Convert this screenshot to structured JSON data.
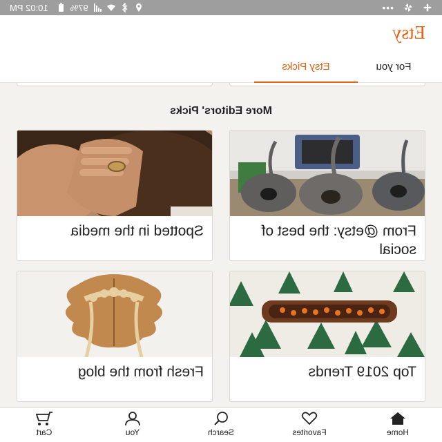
{
  "status_bar": {
    "time": "10:02 PM",
    "battery": "97%",
    "icons": [
      "battery-icon",
      "signal-icon",
      "wifi-icon",
      "bluetooth-icon",
      "location-icon",
      "more-icon",
      "pinwheel-icon",
      "fan-icon"
    ]
  },
  "header": {
    "logo": "Etsy",
    "tabs": [
      {
        "label": "For you",
        "active": false
      },
      {
        "label": "Etsy Picks",
        "active": true
      }
    ],
    "accent_color": "#e8600d"
  },
  "main": {
    "section_title": "More Editors' Picks",
    "cards": [
      {
        "title": "From @etsy: the best of social",
        "image": "felt-cat-pods-photo"
      },
      {
        "title": "Spotted in the media",
        "image": "woman-with-ring-photo"
      },
      {
        "title": "Top 2019 Trends",
        "image": "wooden-tray-pine-trees-photo"
      },
      {
        "title": "Fresh from the blog",
        "image": "leaf-hair-pin-photo"
      }
    ]
  },
  "bottom_nav": {
    "items": [
      {
        "label": "Home",
        "icon": "home-icon",
        "active": true
      },
      {
        "label": "Favorites",
        "icon": "heart-icon",
        "active": false
      },
      {
        "label": "Search",
        "icon": "search-icon",
        "active": false
      },
      {
        "label": "You",
        "icon": "person-icon",
        "active": false
      },
      {
        "label": "Cart",
        "icon": "cart-icon",
        "active": false
      }
    ]
  }
}
